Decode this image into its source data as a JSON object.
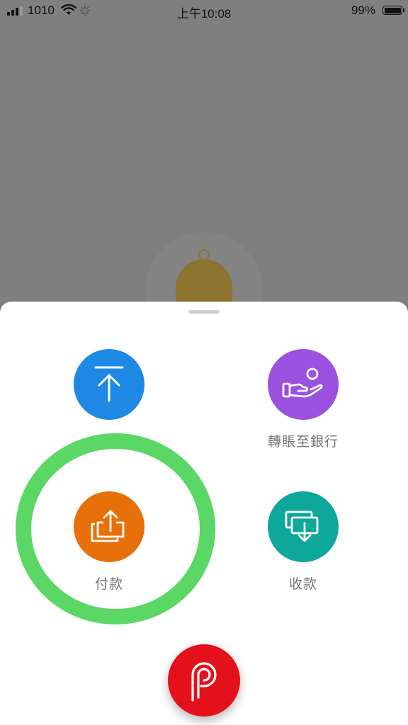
{
  "status_bar": {
    "carrier": "1010",
    "time": "上午10:08",
    "battery_percent": "99%"
  },
  "actions": {
    "top": {
      "label": "",
      "color": "#1e88e5",
      "icon": "upload-arrow-icon"
    },
    "bank_transfer": {
      "label": "轉賬至銀行",
      "color": "#9b51e0",
      "icon": "hand-coin-icon"
    },
    "pay": {
      "label": "付款",
      "color": "#e8700a",
      "icon": "share-out-icon"
    },
    "receive": {
      "label": "收款",
      "color": "#0ea89b",
      "icon": "receive-cards-icon"
    }
  },
  "fab": {
    "icon": "payme-logo-icon",
    "color": "#e4111c"
  },
  "highlight": {
    "color": "#5ad764"
  }
}
